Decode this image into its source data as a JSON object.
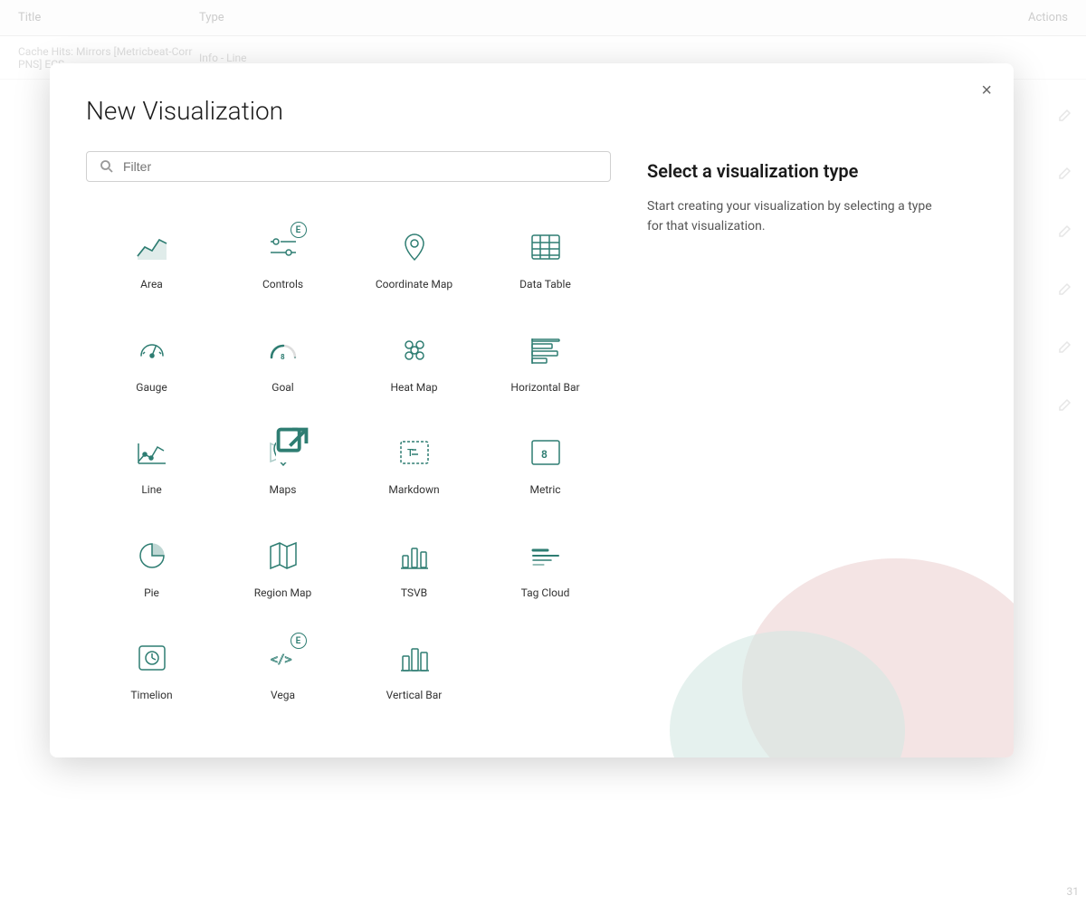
{
  "background": {
    "header": {
      "title_col": "Title",
      "type_col": "Type",
      "actions_col": "Actions"
    },
    "row": {
      "title": "Cache Hits: Mirrors [Metricbeat-Corr PNS] ECS",
      "type": "Info - Line"
    },
    "bottom_right": "31"
  },
  "modal": {
    "title": "New Visualization",
    "close_label": "×",
    "search_placeholder": "Filter",
    "right_panel": {
      "title": "Select a visualization type",
      "description": "Start creating your visualization by selecting a type for that visualization."
    },
    "viz_items": [
      {
        "id": "area",
        "label": "Area",
        "icon": "area"
      },
      {
        "id": "controls",
        "label": "Controls",
        "icon": "controls",
        "badge": "E"
      },
      {
        "id": "coordinate-map",
        "label": "Coordinate\nMap",
        "icon": "coordinate-map"
      },
      {
        "id": "data-table",
        "label": "Data Table",
        "icon": "data-table"
      },
      {
        "id": "gauge",
        "label": "Gauge",
        "icon": "gauge"
      },
      {
        "id": "goal",
        "label": "Goal",
        "icon": "goal"
      },
      {
        "id": "heat-map",
        "label": "Heat Map",
        "icon": "heat-map"
      },
      {
        "id": "horizontal-bar",
        "label": "Horizontal Bar",
        "icon": "horizontal-bar"
      },
      {
        "id": "line",
        "label": "Line",
        "icon": "line"
      },
      {
        "id": "maps",
        "label": "Maps",
        "icon": "maps",
        "badge_ext": true
      },
      {
        "id": "markdown",
        "label": "Markdown",
        "icon": "markdown"
      },
      {
        "id": "metric",
        "label": "Metric",
        "icon": "metric"
      },
      {
        "id": "pie",
        "label": "Pie",
        "icon": "pie"
      },
      {
        "id": "region-map",
        "label": "Region Map",
        "icon": "region-map"
      },
      {
        "id": "tsvb",
        "label": "TSVB",
        "icon": "tsvb"
      },
      {
        "id": "tag-cloud",
        "label": "Tag Cloud",
        "icon": "tag-cloud"
      },
      {
        "id": "timelion",
        "label": "Timelion",
        "icon": "timelion"
      },
      {
        "id": "vega",
        "label": "Vega",
        "icon": "vega",
        "badge": "E"
      },
      {
        "id": "vertical-bar",
        "label": "Vertical Bar",
        "icon": "vertical-bar"
      }
    ]
  }
}
